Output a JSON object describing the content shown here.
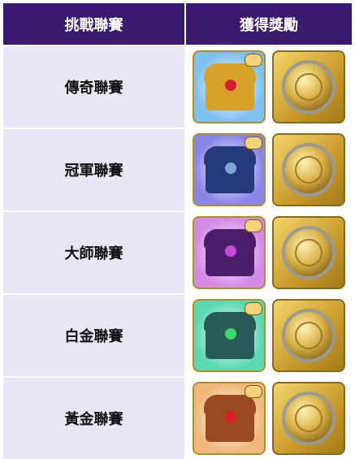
{
  "header": {
    "col1": "挑戰聯賽",
    "col2": "獲得獎勵"
  },
  "rows": [
    {
      "league": "傳奇聯賽",
      "chest_bg": "#7ec0f0",
      "chest_color": "#d8a12a",
      "gem": "#d4202e"
    },
    {
      "league": "冠軍聯賽",
      "chest_bg": "#8a86e8",
      "chest_color": "#243a7a",
      "gem": "#7ea6d8"
    },
    {
      "league": "大師聯賽",
      "chest_bg": "#d48ae6",
      "chest_color": "#4a1e6a",
      "gem": "#c94ad8"
    },
    {
      "league": "白金聯賽",
      "chest_bg": "#5cd8b0",
      "chest_color": "#2a5a58",
      "gem": "#3ad86a"
    },
    {
      "league": "黃金聯賽",
      "chest_bg": "#f0b87a",
      "chest_color": "#9a4a22",
      "gem": "#d8202a"
    }
  ],
  "colors": {
    "header_bg": "#3a1a6e",
    "row_bg": "#e9e6f6"
  }
}
